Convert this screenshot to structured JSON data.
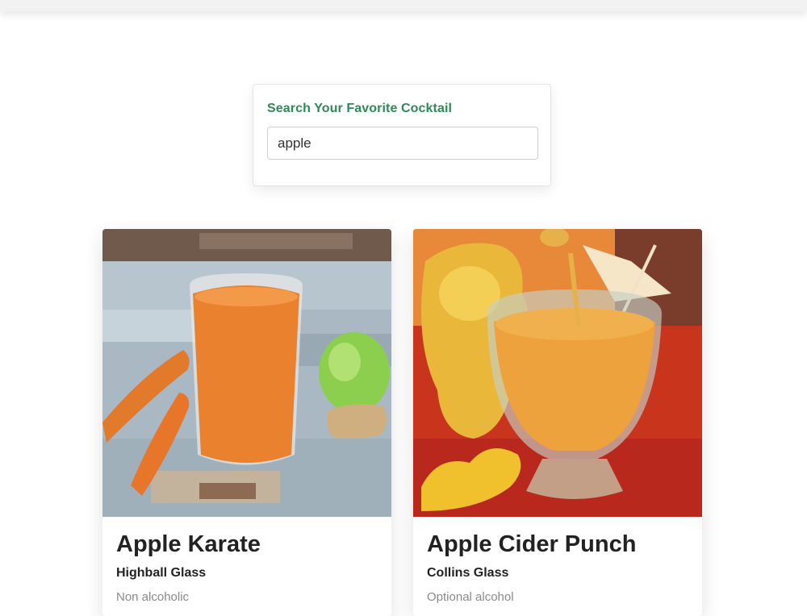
{
  "search": {
    "label": "Search Your Favorite Cocktail",
    "value": "apple"
  },
  "cocktails": [
    {
      "name": "Apple Karate",
      "glass": "Highball Glass",
      "type": "Non alcoholic",
      "image": "carrot-apple-juice-photo"
    },
    {
      "name": "Apple Cider Punch",
      "glass": "Collins Glass",
      "type": "Optional alcohol",
      "image": "tiki-punch-photo"
    }
  ],
  "colors": {
    "accent": "#2e8b57",
    "title": "#222222",
    "muted": "#8a8a8a"
  }
}
